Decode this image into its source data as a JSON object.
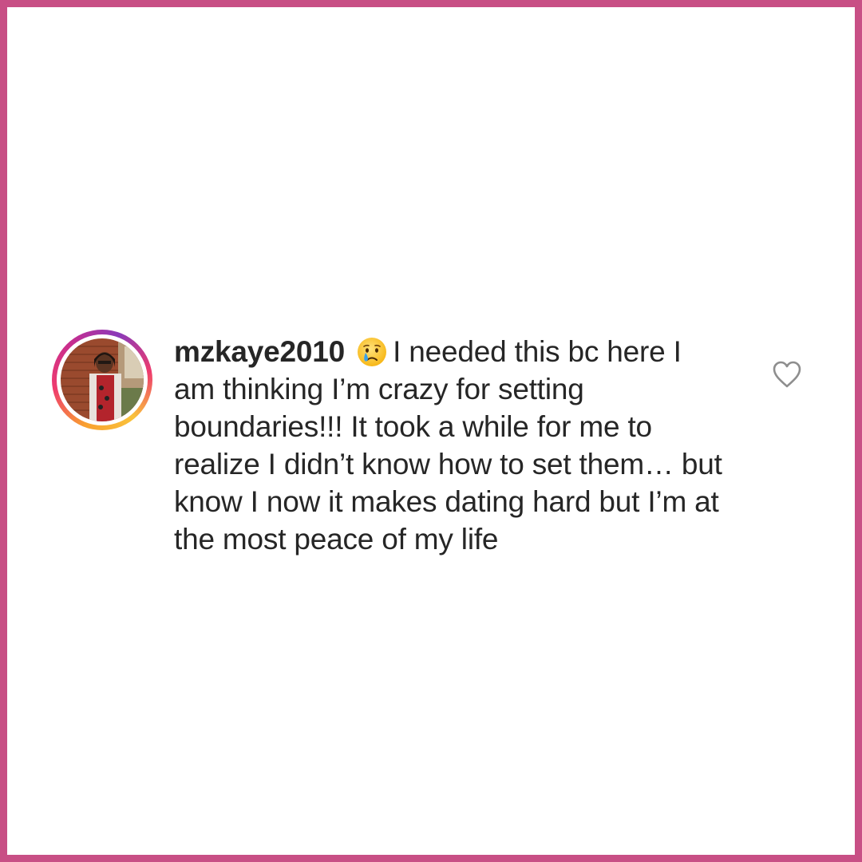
{
  "frame": {
    "border_color": "#c84f85"
  },
  "comment": {
    "avatar_icon": "profile-photo",
    "username": "mzkaye2010",
    "emoji_icon": "crying-face-emoji",
    "text": "I needed this bc here I am thinking I’m crazy for setting boundaries!!! It took a while for me to realize I didn’t know how to set them… but know I now it makes dating hard but I’m at the most peace of my life",
    "like_icon": "heart-outline-icon",
    "text_color": "#262626"
  }
}
